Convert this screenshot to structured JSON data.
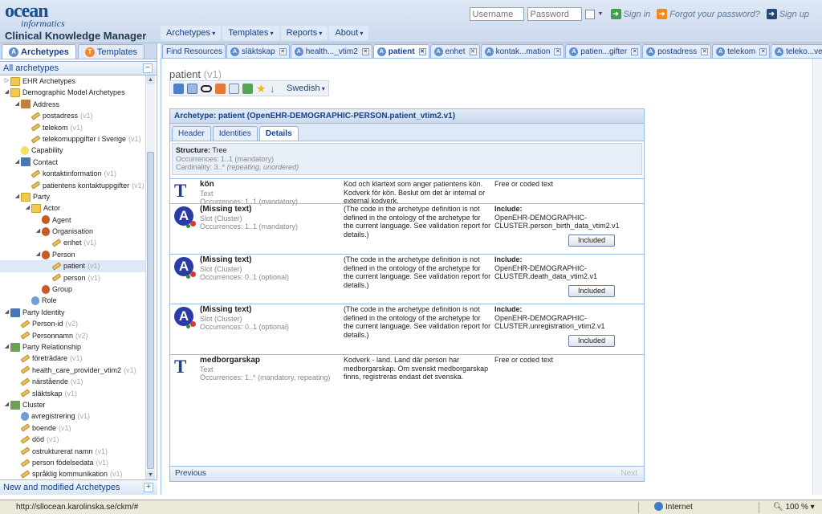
{
  "header": {
    "logo_name": "ocean",
    "logo_sub": "informatics",
    "app_title": "Clinical Knowledge Manager",
    "username_placeholder": "Username",
    "password_placeholder": "Password",
    "sign_in": "Sign in",
    "forgot": "Forgot your password?",
    "sign_up": "Sign up"
  },
  "menu": [
    "Archetypes",
    "Templates",
    "Reports",
    "About"
  ],
  "left": {
    "tab_archetypes": "Archetypes",
    "tab_templates": "Templates",
    "all_label": "All archetypes",
    "footer": "New and modified Archetypes",
    "tree": [
      {
        "label": "EHR Archetypes",
        "level": 0,
        "tog": "▷",
        "icon": "folder",
        "ver": ""
      },
      {
        "label": "Demographic Model Archetypes",
        "level": 0,
        "tog": "◢",
        "icon": "folder",
        "ver": ""
      },
      {
        "label": "Address",
        "level": 1,
        "tog": "◢",
        "icon": "home",
        "ver": ""
      },
      {
        "label": "postadress",
        "level": 2,
        "tog": "",
        "icon": "leaf",
        "ver": "(v1)"
      },
      {
        "label": "telekom",
        "level": 2,
        "tog": "",
        "icon": "leaf",
        "ver": "(v1)"
      },
      {
        "label": "telekomuppgifter i Sverige",
        "level": 2,
        "tog": "",
        "icon": "leaf",
        "ver": "(v1)"
      },
      {
        "label": "Capability",
        "level": 1,
        "tog": "",
        "icon": "bulb",
        "ver": ""
      },
      {
        "label": "Contact",
        "level": 1,
        "tog": "◢",
        "icon": "id",
        "ver": ""
      },
      {
        "label": "kontaktinformation",
        "level": 2,
        "tog": "",
        "icon": "leaf",
        "ver": "(v1)"
      },
      {
        "label": "patientens kontaktuppgifter",
        "level": 2,
        "tog": "",
        "icon": "leaf",
        "ver": "(v1)"
      },
      {
        "label": "Party",
        "level": 1,
        "tog": "◢",
        "icon": "folder",
        "ver": ""
      },
      {
        "label": "Actor",
        "level": 2,
        "tog": "◢",
        "icon": "folder",
        "ver": ""
      },
      {
        "label": "Agent",
        "level": 3,
        "tog": "",
        "icon": "person",
        "ver": ""
      },
      {
        "label": "Organisation",
        "level": 3,
        "tog": "◢",
        "icon": "person",
        "ver": ""
      },
      {
        "label": "enhet",
        "level": 4,
        "tog": "",
        "icon": "leaf",
        "ver": "(v1)"
      },
      {
        "label": "Person",
        "level": 3,
        "tog": "◢",
        "icon": "person",
        "ver": ""
      },
      {
        "label": "patient",
        "level": 4,
        "tog": "",
        "icon": "leaf",
        "ver": "(v1)",
        "selected": true
      },
      {
        "label": "person",
        "level": 4,
        "tog": "",
        "icon": "leaf",
        "ver": "(v1)"
      },
      {
        "label": "Group",
        "level": 3,
        "tog": "",
        "icon": "person",
        "ver": ""
      },
      {
        "label": "Role",
        "level": 2,
        "tog": "",
        "icon": "blue",
        "ver": ""
      },
      {
        "label": "Party Identity",
        "level": 0,
        "tog": "◢",
        "icon": "id",
        "ver": ""
      },
      {
        "label": "Person-id",
        "level": 1,
        "tog": "",
        "icon": "leaf",
        "ver": "(v2)"
      },
      {
        "label": "Personnamn",
        "level": 1,
        "tog": "",
        "icon": "leaf",
        "ver": "(v2)"
      },
      {
        "label": "Party Relationship",
        "level": 0,
        "tog": "◢",
        "icon": "cluster",
        "ver": ""
      },
      {
        "label": "företrädare",
        "level": 1,
        "tog": "",
        "icon": "leaf",
        "ver": "(v1)"
      },
      {
        "label": "health_care_provider_vtim2",
        "level": 1,
        "tog": "",
        "icon": "leaf",
        "ver": "(v1)"
      },
      {
        "label": "närstående",
        "level": 1,
        "tog": "",
        "icon": "leaf",
        "ver": "(v1)"
      },
      {
        "label": "släktskap",
        "level": 1,
        "tog": "",
        "icon": "leaf",
        "ver": "(v1)"
      },
      {
        "label": "Cluster",
        "level": 0,
        "tog": "◢",
        "icon": "cluster",
        "ver": ""
      },
      {
        "label": "avregistrering",
        "level": 1,
        "tog": "",
        "icon": "blue",
        "ver": "(v1)"
      },
      {
        "label": "boende",
        "level": 1,
        "tog": "",
        "icon": "leaf",
        "ver": "(v1)"
      },
      {
        "label": "död",
        "level": 1,
        "tog": "",
        "icon": "leaf",
        "ver": "(v1)"
      },
      {
        "label": "ostrukturerat namn",
        "level": 1,
        "tog": "",
        "icon": "leaf",
        "ver": "(v1)"
      },
      {
        "label": "person födelsedata",
        "level": 1,
        "tog": "",
        "icon": "leaf",
        "ver": "(v1)"
      },
      {
        "label": "språklig kommunikation",
        "level": 1,
        "tog": "",
        "icon": "leaf",
        "ver": "(v1)"
      }
    ]
  },
  "tabs": [
    {
      "label": "Find Resources",
      "icon": false,
      "close": false
    },
    {
      "label": "släktskap",
      "icon": true,
      "close": true
    },
    {
      "label": "health..._vtim2",
      "icon": true,
      "close": true
    },
    {
      "label": "patient",
      "icon": true,
      "close": true,
      "active": true
    },
    {
      "label": "enhet",
      "icon": true,
      "close": true
    },
    {
      "label": "kontak...mation",
      "icon": true,
      "close": true
    },
    {
      "label": "patien...gifter",
      "icon": true,
      "close": true
    },
    {
      "label": "postadress",
      "icon": true,
      "close": true
    },
    {
      "label": "telekom",
      "icon": true,
      "close": true
    },
    {
      "label": "teleko...verige",
      "icon": true,
      "close": true
    }
  ],
  "content": {
    "title": "patient",
    "version": "(v1)",
    "language": "Swedish",
    "archetype_header": "Archetype: patient (OpenEHR-DEMOGRAPHIC-PERSON.patient_vtim2.v1)",
    "detail_tabs": [
      "Header",
      "Identities",
      "Details"
    ],
    "structure_label": "Structure:",
    "structure_value": "Tree",
    "occurrences": "Occurrences: 1..1 (mandatory)",
    "cardinality": "Cardinality: 3..* ",
    "cardinality_note": "(repeating, unordered)",
    "rows": [
      {
        "kind": "text",
        "name": "kön",
        "type": "Text",
        "occ": "Occurrences: 1..1 (mandatory)",
        "desc": "Kod och klartext som anger patientens kön. Kodverk för kön. Beslut om det är internal or external kodverk.",
        "constraint_label": "",
        "constraint": "Free or coded text",
        "button": "",
        "height": 31
      },
      {
        "kind": "slot",
        "name": "(Missing text)",
        "type": "Slot (Cluster)",
        "occ": "Occurrences: 1..1 (mandatory)",
        "desc": "(The code in the archetype definition is not defined in the ontology of the archetype for the current language. See validation report for details.)",
        "constraint_label": "Include:",
        "constraint": "OpenEHR-DEMOGRAPHIC-CLUSTER.person_birth_data_vtim2.v1",
        "button": "Included",
        "height": 63
      },
      {
        "kind": "slot",
        "name": "(Missing text)",
        "type": "Slot (Cluster)",
        "occ": "Occurrences: 0..1 (optional)",
        "desc": "(The code in the archetype definition is not defined in the ontology of the archetype for the current language. See validation report for details.)",
        "constraint_label": "Include:",
        "constraint": "OpenEHR-DEMOGRAPHIC-CLUSTER.death_data_vtim2.v1",
        "button": "Included",
        "height": 62
      },
      {
        "kind": "slot",
        "name": "(Missing text)",
        "type": "Slot (Cluster)",
        "occ": "Occurrences: 0..1 (optional)",
        "desc": "(The code in the archetype definition is not defined in the ontology of the archetype for the current language. See validation report for details.)",
        "constraint_label": "Include:",
        "constraint": "OpenEHR-DEMOGRAPHIC-CLUSTER.unregistration_vtim2.v1",
        "button": "Included",
        "height": 63
      },
      {
        "kind": "text",
        "name": "medborgarskap",
        "type": "Text",
        "occ": "Occurrences: 1..* (mandatory, repeating)",
        "desc": "Kodverk - land. Land där person har medborgarskap. Om svenskt medborgarskap finns, registreras endast det svenska.",
        "constraint_label": "",
        "constraint": "Free or coded text",
        "button": "",
        "height": 36
      }
    ],
    "prev": "Previous",
    "next": "Next"
  },
  "status": {
    "url": "http://sllocean.karolinska.se/ckm/#",
    "zone": "Internet",
    "zoom": "100 %"
  }
}
